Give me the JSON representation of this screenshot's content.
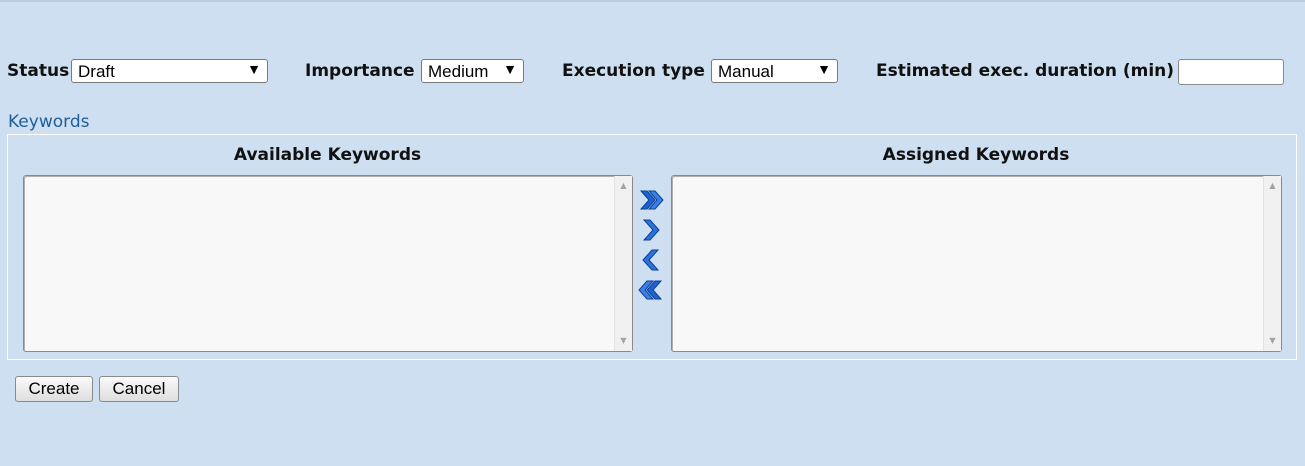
{
  "form": {
    "status": {
      "label": "Status",
      "value": "Draft"
    },
    "importance": {
      "label": "Importance",
      "value": "Medium"
    },
    "execution_type": {
      "label": "Execution type",
      "value": "Manual"
    },
    "estimated_duration": {
      "label": "Estimated exec. duration (min)",
      "value": ""
    }
  },
  "keywords": {
    "section_title": "Keywords",
    "available_heading": "Available Keywords",
    "assigned_heading": "Assigned Keywords",
    "available_items": [],
    "assigned_items": []
  },
  "actions": {
    "create_label": "Create",
    "cancel_label": "Cancel"
  },
  "icons": {
    "move_all_right": "double-chevron-right-icon",
    "move_right": "chevron-right-icon",
    "move_left": "chevron-left-icon",
    "move_all_left": "double-chevron-left-icon",
    "dropdown": "triangle-down-icon",
    "scroll_up": "scroll-up-arrow-icon",
    "scroll_down": "scroll-down-arrow-icon"
  },
  "colors": {
    "page_background": "#cddff0",
    "section_title": "#1f5f97",
    "move_arrows": "#1d62d1"
  }
}
